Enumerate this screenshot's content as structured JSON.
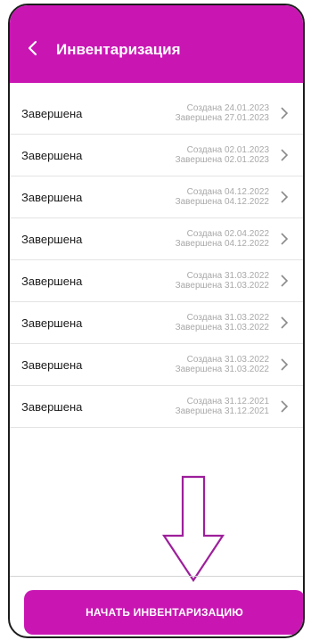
{
  "header": {
    "back_icon": "chevron-left-icon",
    "title": "Инвентаризация",
    "color": "#c916b3"
  },
  "inventory_list": [
    {
      "status": "Завершена",
      "created": "Создана 24.01.2023",
      "completed": "Завершена 27.01.2023"
    },
    {
      "status": "Завершена",
      "created": "Создана 02.01.2023",
      "completed": "Завершена 02.01.2023"
    },
    {
      "status": "Завершена",
      "created": "Создана 04.12.2022",
      "completed": "Завершена 04.12.2022"
    },
    {
      "status": "Завершена",
      "created": "Создана 02.04.2022",
      "completed": "Завершена 04.12.2022"
    },
    {
      "status": "Завершена",
      "created": "Создана 31.03.2022",
      "completed": "Завершена 31.03.2022"
    },
    {
      "status": "Завершена",
      "created": "Создана 31.03.2022",
      "completed": "Завершена 31.03.2022"
    },
    {
      "status": "Завершена",
      "created": "Создана 31.03.2022",
      "completed": "Завершена 31.03.2022"
    },
    {
      "status": "Завершена",
      "created": "Создана 31.12.2021",
      "completed": "Завершена 31.12.2021"
    }
  ],
  "annotation": {
    "icon": "down-arrow-icon"
  },
  "start_button": {
    "label": "НАЧАТЬ ИНВЕНТАРИЗАЦИЮ",
    "color": "#c916b3"
  }
}
